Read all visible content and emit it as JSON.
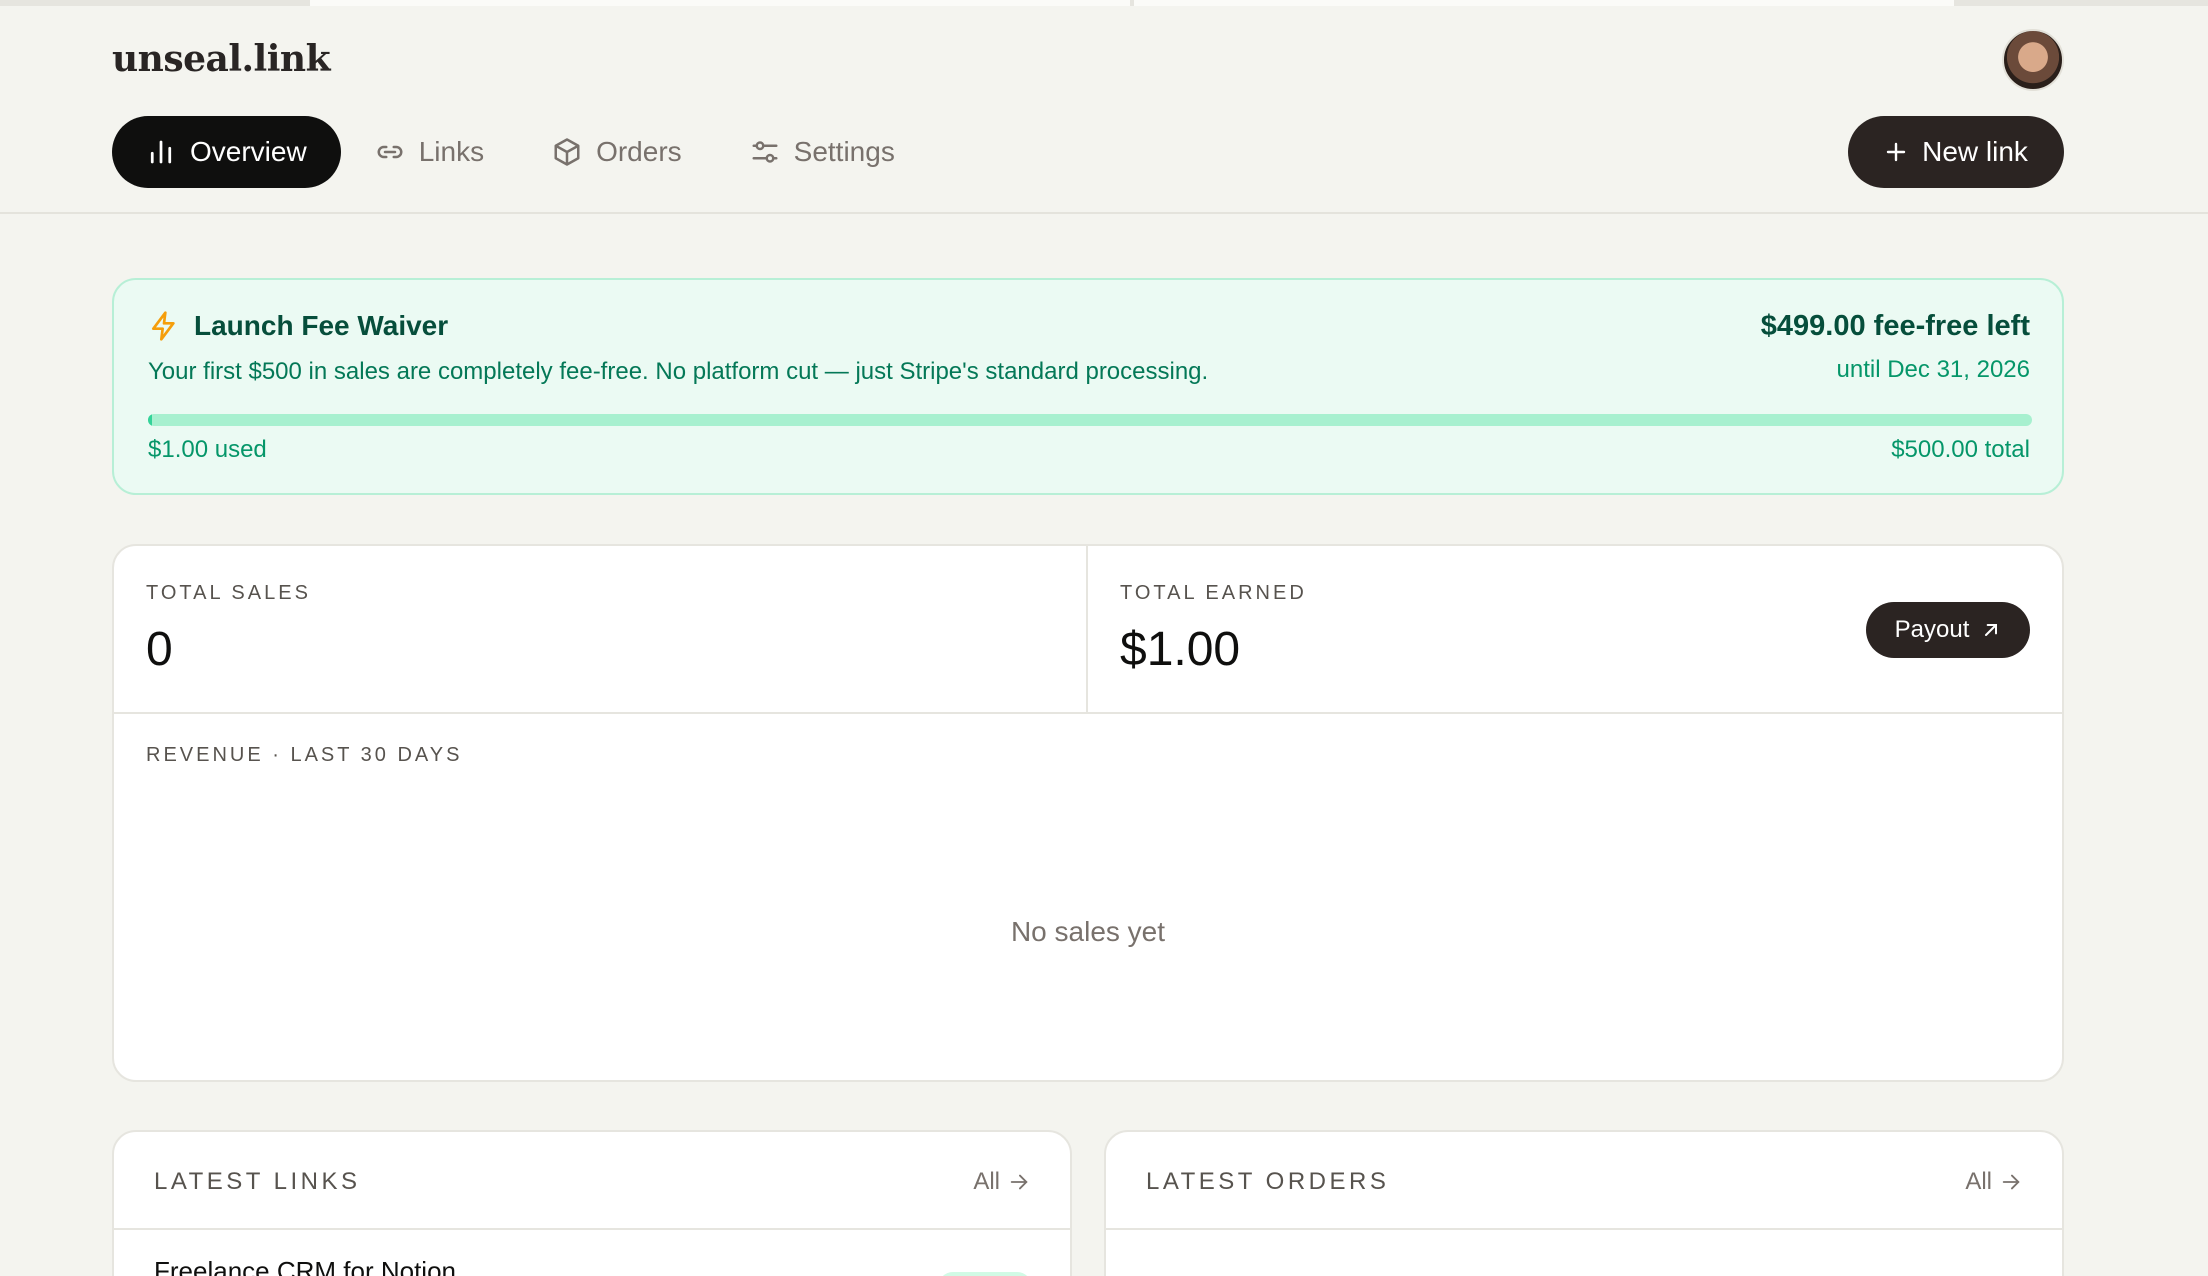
{
  "app": {
    "brand": "unseal.link"
  },
  "nav": {
    "items": [
      {
        "label": "Overview",
        "icon": "bar-chart-icon",
        "active": true
      },
      {
        "label": "Links",
        "icon": "link-icon",
        "active": false
      },
      {
        "label": "Orders",
        "icon": "package-icon",
        "active": false
      },
      {
        "label": "Settings",
        "icon": "sliders-icon",
        "active": false
      }
    ],
    "new_link_label": "New link"
  },
  "waiver": {
    "title": "Launch Fee Waiver",
    "icon": "lightning-icon",
    "description": "Your first $500 in sales are completely fee-free. No platform cut — just Stripe's standard processing.",
    "remaining": "$499.00 fee-free left",
    "until": "until Dec 31, 2026",
    "used": "$1.00 used",
    "total": "$500.00 total",
    "progress_fraction": 0.002
  },
  "stats": {
    "total_sales_label": "TOTAL SALES",
    "total_sales_value": "0",
    "total_earned_label": "TOTAL EARNED",
    "total_earned_value": "$1.00",
    "payout_label": "Payout"
  },
  "revenue": {
    "label": "REVENUE · LAST 30 DAYS",
    "empty_text": "No sales yet"
  },
  "latest_links": {
    "title": "LATEST LINKS",
    "all_label": "All",
    "first_item": "Freelance CRM for Notion"
  },
  "latest_orders": {
    "title": "LATEST ORDERS",
    "all_label": "All"
  },
  "colors": {
    "accent_dark": "#0f0f0e",
    "waiver_bg": "#ebfaf3",
    "waiver_text": "#064e3b",
    "progress_fill": "#34d399",
    "lightning": "#f59e0b"
  }
}
